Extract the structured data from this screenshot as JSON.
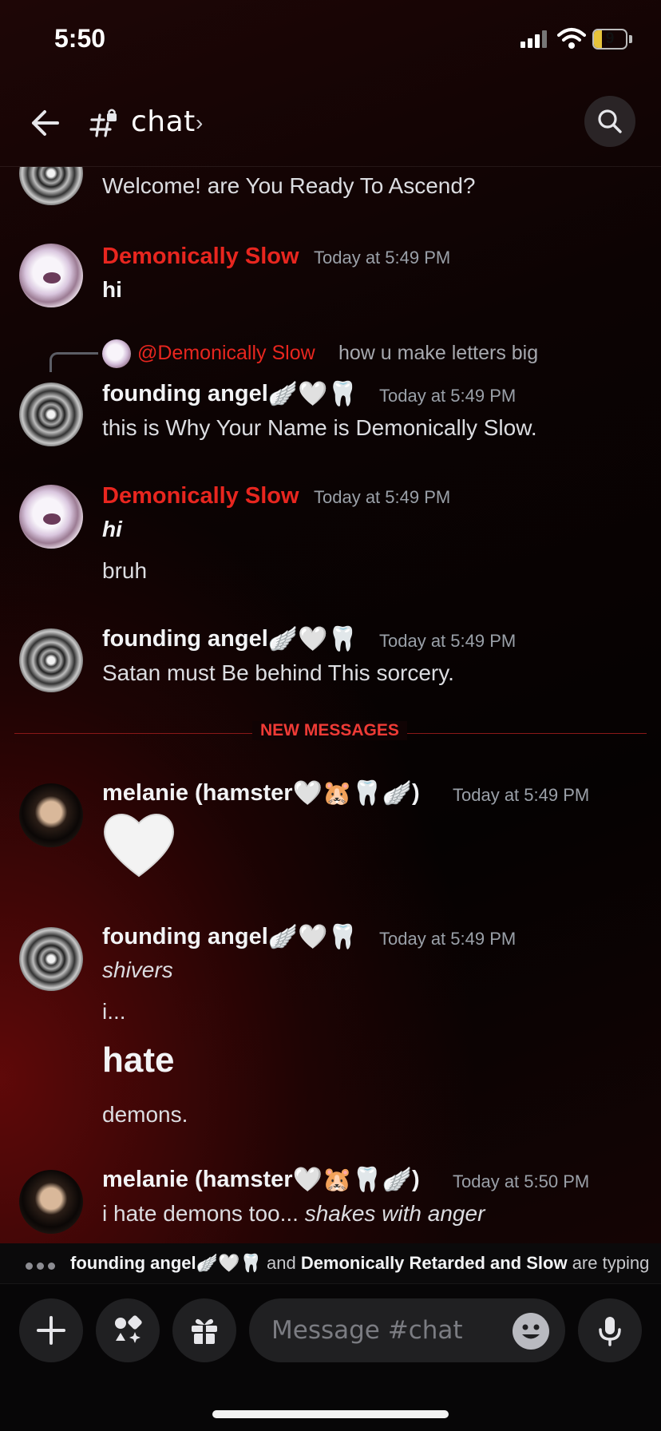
{
  "status_bar": {
    "time": "5:50",
    "battery": "9"
  },
  "header": {
    "channel_name": "chat",
    "chevron": "›"
  },
  "messages": [
    {
      "text": "Welcome! are You Ready To Ascend?"
    },
    {
      "user": "Demonically Slow",
      "time": "Today at 5:49 PM",
      "text": "hi"
    },
    {
      "reply_to": {
        "user": "@Demonically Slow",
        "text": "how u make letters big"
      },
      "user": "founding angel",
      "user_emojis": "🪽🤍🦷",
      "time": "Today at 5:49 PM",
      "text": "this is Why Your Name is Demonically Slow."
    },
    {
      "user": "Demonically Slow",
      "time": "Today at 5:49 PM",
      "lines": [
        "hi",
        "bruh"
      ]
    },
    {
      "user": "founding angel",
      "user_emojis": "🪽🤍🦷",
      "time": "Today at 5:49 PM",
      "text": "Satan must Be behind This sorcery."
    },
    {
      "user": "melanie (hamster",
      "user_emojis": "🤍🐹🦷🪽",
      "user_suffix": ")",
      "time": "Today at 5:49 PM",
      "big_emoji": "🤍"
    },
    {
      "user": "founding angel",
      "user_emojis": "🪽🤍🦷",
      "time": "Today at 5:49 PM",
      "lines": [
        "shivers",
        "i...",
        "hate",
        "demons."
      ]
    },
    {
      "user": "melanie (hamster",
      "user_emojis": "🤍🐹🦷🪽",
      "user_suffix": ")",
      "time": "Today at 5:50 PM",
      "text": "i hate demons too... ",
      "text_italic": "shakes with anger"
    }
  ],
  "divider": {
    "label": "NEW MESSAGES"
  },
  "typing": {
    "user1": "founding angel",
    "user1_emojis": "🪽🤍🦷",
    "and": "and",
    "user2": "Demonically Retarded and Slow",
    "suffix": "are typing"
  },
  "composer": {
    "placeholder": "Message #chat"
  },
  "icons": [
    "back-arrow-icon",
    "channel-hash-lock-icon",
    "search-icon",
    "plus-icon",
    "apps-icon",
    "gift-icon",
    "emoji-icon",
    "microphone-icon"
  ]
}
